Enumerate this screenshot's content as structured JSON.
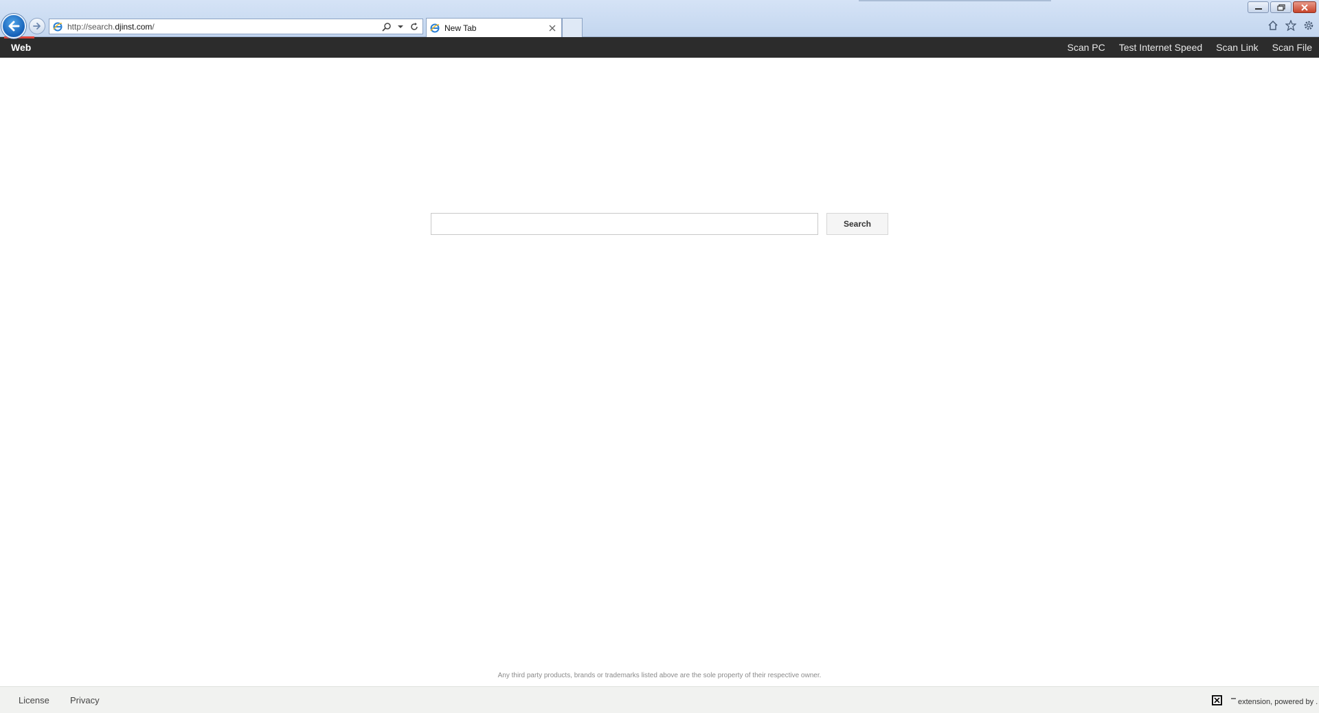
{
  "browser": {
    "url_prefix": "http://search.",
    "url_domain": "djinst.com",
    "url_suffix": "/",
    "tab_title": "New Tab",
    "icons": [
      "back-arrow-icon",
      "forward-arrow-icon",
      "ie-logo-icon",
      "search-icon",
      "dropdown-icon",
      "refresh-icon",
      "close-icon",
      "home-icon",
      "star-icon",
      "gear-icon",
      "minimize-icon",
      "restore-icon",
      "window-close-icon"
    ]
  },
  "nav": {
    "brand": "Web",
    "links": [
      "Scan PC",
      "Test Internet Speed",
      "Scan Link",
      "Scan File"
    ]
  },
  "search": {
    "placeholder": "",
    "button_label": "Search"
  },
  "footer": {
    "disclaimer": "Any third party products, brands or trademarks listed above are the sole property of their respective owner.",
    "license_label": "License",
    "privacy_label": "Privacy",
    "extension_text": "extension, powered by ."
  },
  "colors": {
    "navbar_bg": "#2c2c2c",
    "chrome_bg": "#c3d6ef",
    "footer_bg": "#f1f2f0",
    "back_button": "#1560b8"
  }
}
